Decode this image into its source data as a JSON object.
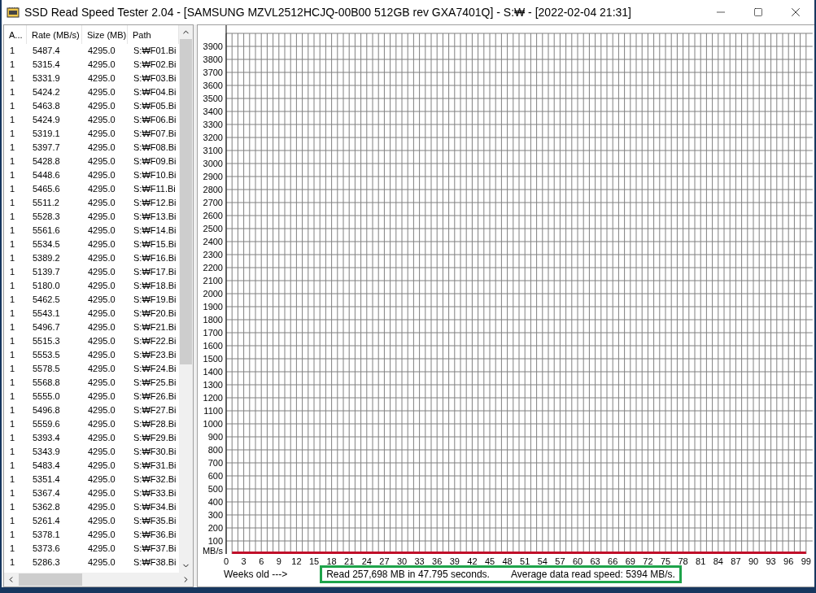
{
  "window": {
    "title": "SSD Read Speed Tester 2.04 - [SAMSUNG MZVL2512HCJQ-00B00 512GB rev GXA7401Q] - S:₩ - [2022-02-04 21:31]"
  },
  "table": {
    "columns": [
      "A...",
      "Rate (MB/s)",
      "Size (MB)",
      "Path"
    ],
    "rows": [
      [
        "1",
        "5487.4",
        "4295.0",
        "S:₩F01.Bi"
      ],
      [
        "1",
        "5315.4",
        "4295.0",
        "S:₩F02.Bi"
      ],
      [
        "1",
        "5331.9",
        "4295.0",
        "S:₩F03.Bi"
      ],
      [
        "1",
        "5424.2",
        "4295.0",
        "S:₩F04.Bi"
      ],
      [
        "1",
        "5463.8",
        "4295.0",
        "S:₩F05.Bi"
      ],
      [
        "1",
        "5424.9",
        "4295.0",
        "S:₩F06.Bi"
      ],
      [
        "1",
        "5319.1",
        "4295.0",
        "S:₩F07.Bi"
      ],
      [
        "1",
        "5397.7",
        "4295.0",
        "S:₩F08.Bi"
      ],
      [
        "1",
        "5428.8",
        "4295.0",
        "S:₩F09.Bi"
      ],
      [
        "1",
        "5448.6",
        "4295.0",
        "S:₩F10.Bi"
      ],
      [
        "1",
        "5465.6",
        "4295.0",
        "S:₩F11.Bi"
      ],
      [
        "1",
        "5511.2",
        "4295.0",
        "S:₩F12.Bi"
      ],
      [
        "1",
        "5528.3",
        "4295.0",
        "S:₩F13.Bi"
      ],
      [
        "1",
        "5561.6",
        "4295.0",
        "S:₩F14.Bi"
      ],
      [
        "1",
        "5534.5",
        "4295.0",
        "S:₩F15.Bi"
      ],
      [
        "1",
        "5389.2",
        "4295.0",
        "S:₩F16.Bi"
      ],
      [
        "1",
        "5139.7",
        "4295.0",
        "S:₩F17.Bi"
      ],
      [
        "1",
        "5180.0",
        "4295.0",
        "S:₩F18.Bi"
      ],
      [
        "1",
        "5462.5",
        "4295.0",
        "S:₩F19.Bi"
      ],
      [
        "1",
        "5543.1",
        "4295.0",
        "S:₩F20.Bi"
      ],
      [
        "1",
        "5496.7",
        "4295.0",
        "S:₩F21.Bi"
      ],
      [
        "1",
        "5515.3",
        "4295.0",
        "S:₩F22.Bi"
      ],
      [
        "1",
        "5553.5",
        "4295.0",
        "S:₩F23.Bi"
      ],
      [
        "1",
        "5578.5",
        "4295.0",
        "S:₩F24.Bi"
      ],
      [
        "1",
        "5568.8",
        "4295.0",
        "S:₩F25.Bi"
      ],
      [
        "1",
        "5555.0",
        "4295.0",
        "S:₩F26.Bi"
      ],
      [
        "1",
        "5496.8",
        "4295.0",
        "S:₩F27.Bi"
      ],
      [
        "1",
        "5559.6",
        "4295.0",
        "S:₩F28.Bi"
      ],
      [
        "1",
        "5393.4",
        "4295.0",
        "S:₩F29.Bi"
      ],
      [
        "1",
        "5343.9",
        "4295.0",
        "S:₩F30.Bi"
      ],
      [
        "1",
        "5483.4",
        "4295.0",
        "S:₩F31.Bi"
      ],
      [
        "1",
        "5351.4",
        "4295.0",
        "S:₩F32.Bi"
      ],
      [
        "1",
        "5367.4",
        "4295.0",
        "S:₩F33.Bi"
      ],
      [
        "1",
        "5362.8",
        "4295.0",
        "S:₩F34.Bi"
      ],
      [
        "1",
        "5261.4",
        "4295.0",
        "S:₩F35.Bi"
      ],
      [
        "1",
        "5378.1",
        "4295.0",
        "S:₩F36.Bi"
      ],
      [
        "1",
        "5373.6",
        "4295.0",
        "S:₩F37.Bi"
      ],
      [
        "1",
        "5286.3",
        "4295.0",
        "S:₩F38.Bi"
      ]
    ]
  },
  "chart": {
    "chart_data": {
      "type": "line",
      "x": [
        1,
        99
      ],
      "series": [
        {
          "color": "#c0102a",
          "values": [
            10,
            10
          ]
        }
      ],
      "grid": true,
      "xlim": [
        0,
        99
      ],
      "ylim": [
        0,
        4000
      ],
      "xticks": [
        0,
        3,
        6,
        9,
        12,
        15,
        18,
        21,
        24,
        27,
        30,
        33,
        36,
        39,
        42,
        45,
        48,
        51,
        54,
        57,
        60,
        63,
        66,
        69,
        72,
        75,
        78,
        81,
        84,
        87,
        90,
        93,
        96,
        99
      ],
      "yticks": [
        {
          "value": 0,
          "label": "MB/s"
        },
        100,
        200,
        300,
        400,
        500,
        600,
        700,
        800,
        900,
        1000,
        1100,
        1200,
        1300,
        1400,
        1500,
        1600,
        1700,
        1800,
        1900,
        2000,
        2100,
        2200,
        2300,
        2400,
        2500,
        2600,
        2700,
        2800,
        2900,
        3000,
        3100,
        3200,
        3300,
        3400,
        3500,
        3600,
        3700,
        3800,
        3900
      ]
    },
    "xlabel": "Weeks old --->"
  },
  "status": {
    "read": "Read 257,698 MB in 47.795 seconds.",
    "average": "Average data read speed: 5394 MB/s."
  }
}
